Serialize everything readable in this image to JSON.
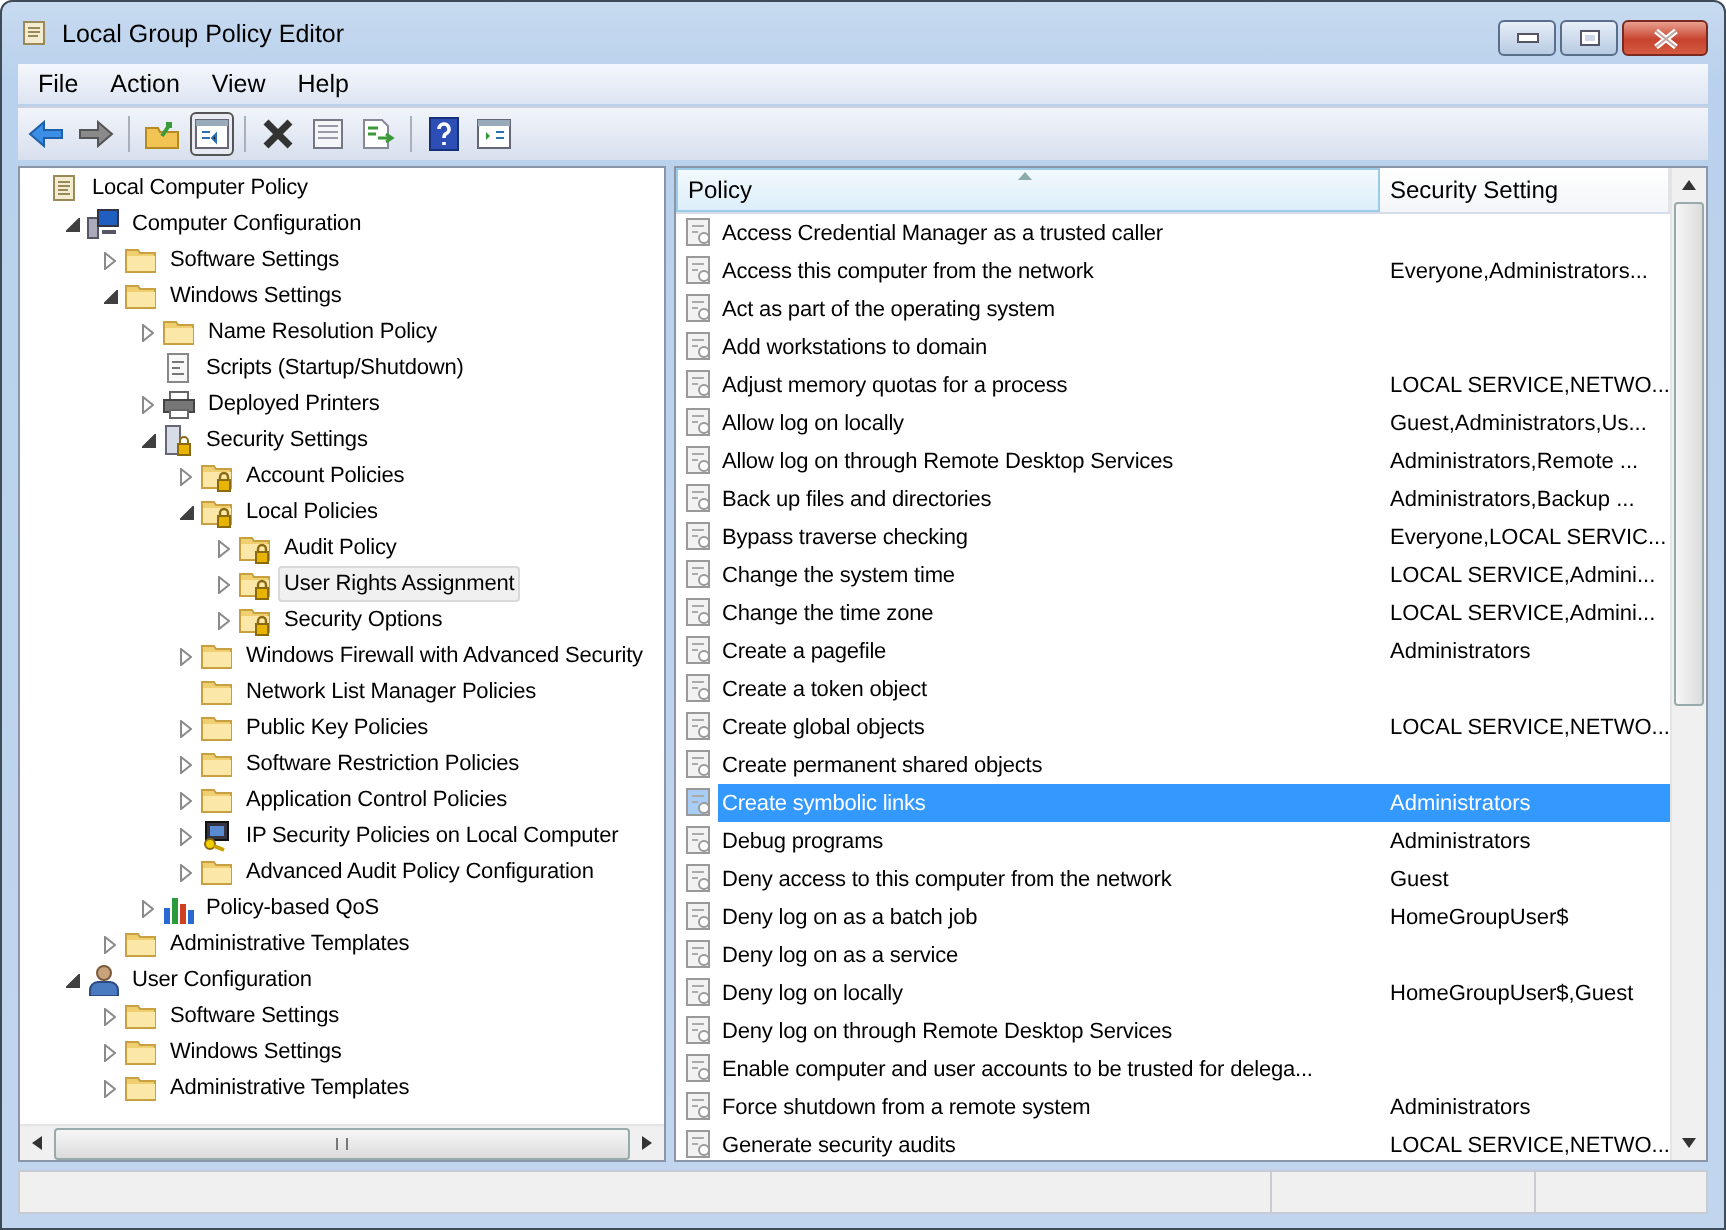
{
  "window": {
    "title": "Local Group Policy Editor"
  },
  "menu": [
    "File",
    "Action",
    "View",
    "Help"
  ],
  "tree": [
    {
      "label": "Local Computer Policy",
      "kind": "policy",
      "selected": false,
      "children": [
        {
          "label": "Computer Configuration",
          "kind": "computer",
          "expanded": true,
          "selected": false,
          "children": [
            {
              "label": "Software Settings",
              "kind": "folder",
              "expanded": false,
              "selected": false
            },
            {
              "label": "Windows Settings",
              "kind": "folder",
              "expanded": true,
              "selected": false,
              "children": [
                {
                  "label": "Name Resolution Policy",
                  "kind": "folder",
                  "expanded": false,
                  "selected": false
                },
                {
                  "label": "Scripts (Startup/Shutdown)",
                  "kind": "script",
                  "selected": false
                },
                {
                  "label": "Deployed Printers",
                  "kind": "printer",
                  "expanded": false,
                  "selected": false
                },
                {
                  "label": "Security Settings",
                  "kind": "server",
                  "expanded": true,
                  "selected": false,
                  "children": [
                    {
                      "label": "Account Policies",
                      "kind": "lockfolder",
                      "expanded": false,
                      "selected": false
                    },
                    {
                      "label": "Local Policies",
                      "kind": "lockfolder",
                      "expanded": true,
                      "selected": false,
                      "children": [
                        {
                          "label": "Audit Policy",
                          "kind": "lockfolder",
                          "expanded": false,
                          "selected": false
                        },
                        {
                          "label": "User Rights Assignment",
                          "kind": "lockfolder",
                          "expanded": false,
                          "selected": true
                        },
                        {
                          "label": "Security Options",
                          "kind": "lockfolder",
                          "expanded": false,
                          "selected": false
                        }
                      ]
                    },
                    {
                      "label": "Windows Firewall with Advanced Security",
                      "kind": "folder",
                      "expanded": false,
                      "selected": false
                    },
                    {
                      "label": "Network List Manager Policies",
                      "kind": "folder",
                      "selected": false
                    },
                    {
                      "label": "Public Key Policies",
                      "kind": "folder",
                      "expanded": false,
                      "selected": false
                    },
                    {
                      "label": "Software Restriction Policies",
                      "kind": "folder",
                      "expanded": false,
                      "selected": false
                    },
                    {
                      "label": "Application Control Policies",
                      "kind": "folder",
                      "expanded": false,
                      "selected": false
                    },
                    {
                      "label": "IP Security Policies on Local Computer",
                      "kind": "ipsec",
                      "expanded": false,
                      "selected": false
                    },
                    {
                      "label": "Advanced Audit Policy Configuration",
                      "kind": "folder",
                      "expanded": false,
                      "selected": false
                    }
                  ]
                },
                {
                  "label": "Policy-based QoS",
                  "kind": "chart",
                  "expanded": false,
                  "selected": false
                }
              ]
            },
            {
              "label": "Administrative Templates",
              "kind": "folder",
              "expanded": false,
              "selected": false
            }
          ]
        },
        {
          "label": "User Configuration",
          "kind": "user",
          "expanded": true,
          "selected": false,
          "children": [
            {
              "label": "Software Settings",
              "kind": "folder",
              "expanded": false,
              "selected": false
            },
            {
              "label": "Windows Settings",
              "kind": "folder",
              "expanded": false,
              "selected": false
            },
            {
              "label": "Administrative Templates",
              "kind": "folder",
              "expanded": false,
              "selected": false
            }
          ]
        }
      ]
    }
  ],
  "table": {
    "columns": [
      "Policy",
      "Security Setting"
    ],
    "rows": [
      {
        "policy": "Access Credential Manager as a trusted caller",
        "selected": false
      },
      {
        "policy": "Access this computer from the network",
        "setting": "Everyone,Administrators...",
        "selected": false
      },
      {
        "policy": "Act as part of the operating system",
        "selected": false
      },
      {
        "policy": "Add workstations to domain",
        "selected": false
      },
      {
        "policy": "Adjust memory quotas for a process",
        "setting": "LOCAL SERVICE,NETWO...",
        "selected": false
      },
      {
        "policy": "Allow log on locally",
        "setting": "Guest,Administrators,Us...",
        "selected": false
      },
      {
        "policy": "Allow log on through Remote Desktop Services",
        "setting": "Administrators,Remote ...",
        "selected": false
      },
      {
        "policy": "Back up files and directories",
        "setting": "Administrators,Backup ...",
        "selected": false
      },
      {
        "policy": "Bypass traverse checking",
        "setting": "Everyone,LOCAL SERVIC...",
        "selected": false
      },
      {
        "policy": "Change the system time",
        "setting": "LOCAL SERVICE,Admini...",
        "selected": false
      },
      {
        "policy": "Change the time zone",
        "setting": "LOCAL SERVICE,Admini...",
        "selected": false
      },
      {
        "policy": "Create a pagefile",
        "setting": "Administrators",
        "selected": false
      },
      {
        "policy": "Create a token object",
        "selected": false
      },
      {
        "policy": "Create global objects",
        "setting": "LOCAL SERVICE,NETWO...",
        "selected": false
      },
      {
        "policy": "Create permanent shared objects",
        "selected": false
      },
      {
        "policy": "Create symbolic links",
        "setting": "Administrators",
        "selected": true
      },
      {
        "policy": "Debug programs",
        "setting": "Administrators",
        "selected": false
      },
      {
        "policy": "Deny access to this computer from the network",
        "setting": "Guest",
        "selected": false
      },
      {
        "policy": "Deny log on as a batch job",
        "setting": "HomeGroupUser$",
        "selected": false
      },
      {
        "policy": "Deny log on as a service",
        "selected": false
      },
      {
        "policy": "Deny log on locally",
        "setting": "HomeGroupUser$,Guest",
        "selected": false
      },
      {
        "policy": "Deny log on through Remote Desktop Services",
        "selected": false
      },
      {
        "policy": "Enable computer and user accounts to be trusted for delega...",
        "selected": false
      },
      {
        "policy": "Force shutdown from a remote system",
        "setting": "Administrators",
        "selected": false
      },
      {
        "policy": "Generate security audits",
        "setting": "LOCAL SERVICE,NETWO...",
        "selected": false
      }
    ]
  }
}
